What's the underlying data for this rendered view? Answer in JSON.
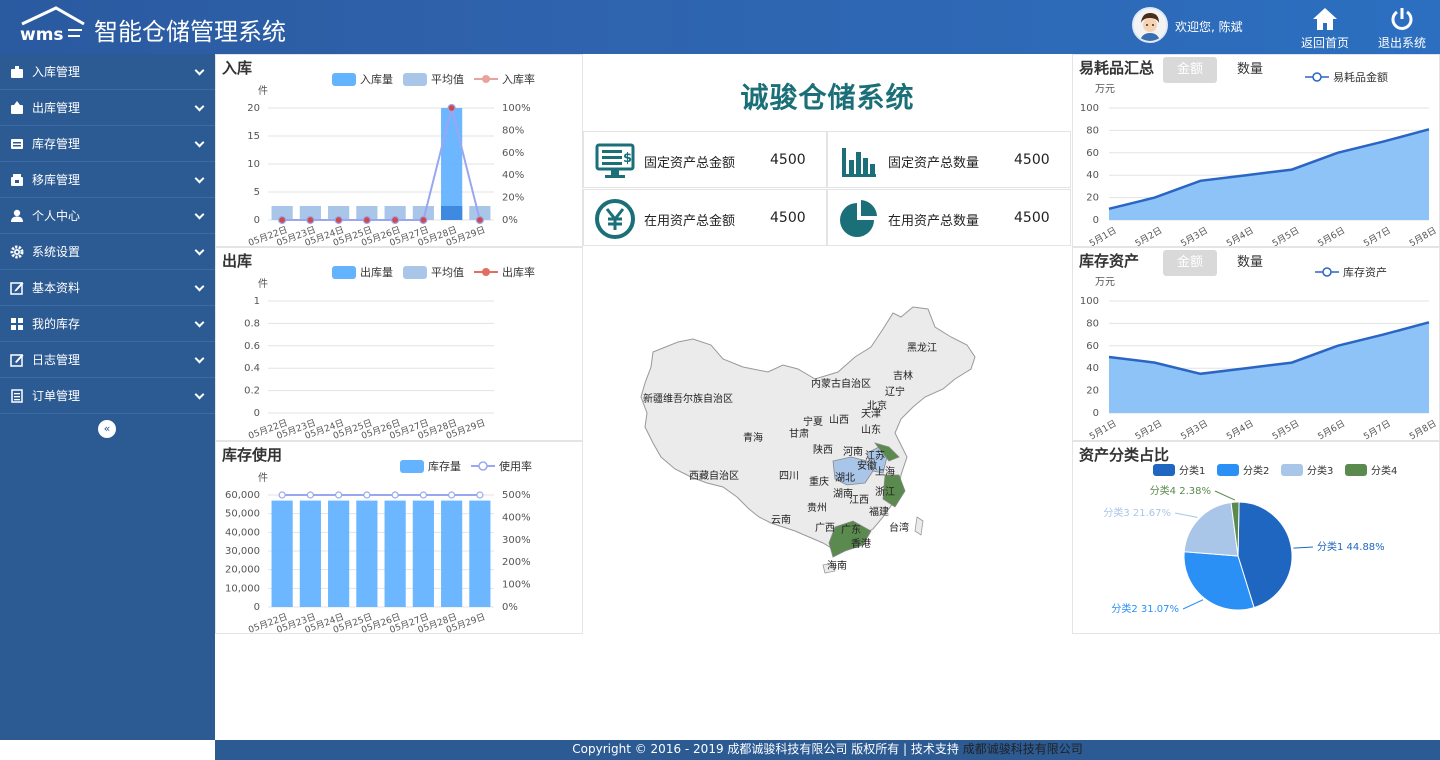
{
  "header": {
    "title": "智能仓储管理系统",
    "welcome": "欢迎您, 陈斌",
    "home_label": "返回首页",
    "logout_label": "退出系统"
  },
  "sidebar": {
    "items": [
      {
        "label": "入库管理",
        "icon": "inbox-in-icon"
      },
      {
        "label": "出库管理",
        "icon": "inbox-out-icon"
      },
      {
        "label": "库存管理",
        "icon": "inventory-icon"
      },
      {
        "label": "移库管理",
        "icon": "transfer-icon"
      },
      {
        "label": "个人中心",
        "icon": "user-icon"
      },
      {
        "label": "系统设置",
        "icon": "gear-icon"
      },
      {
        "label": "基本资料",
        "icon": "edit-icon"
      },
      {
        "label": "我的库存",
        "icon": "grid-icon"
      },
      {
        "label": "日志管理",
        "icon": "log-icon"
      },
      {
        "label": "订单管理",
        "icon": "list-icon"
      }
    ],
    "collapse_symbol": "«"
  },
  "center": {
    "title": "诚骏仓储系统",
    "stats": [
      {
        "label": "固定资产总金额",
        "value": "4500",
        "icon": "monitor-money-icon"
      },
      {
        "label": "固定资产总数量",
        "value": "4500",
        "icon": "bar-chart-icon"
      },
      {
        "label": "在用资产总金额",
        "value": "4500",
        "icon": "yen-icon"
      },
      {
        "label": "在用资产总数量",
        "value": "4500",
        "icon": "pie-icon"
      }
    ]
  },
  "panels": {
    "inbound": {
      "title": "入库",
      "legend": [
        "入库量",
        "平均值",
        "入库率"
      ]
    },
    "outbound": {
      "title": "出库",
      "legend": [
        "出库量",
        "平均值",
        "出库率"
      ]
    },
    "stock_use": {
      "title": "库存使用",
      "legend": [
        "库存量",
        "使用率"
      ]
    },
    "consumables": {
      "title": "易耗品汇总",
      "tab_amount": "金额",
      "tab_count": "数量",
      "legend": [
        "易耗品金额"
      ]
    },
    "stock_assets": {
      "title": "库存资产",
      "tab_amount": "金额",
      "tab_count": "数量",
      "legend": [
        "库存资产"
      ]
    },
    "asset_ratio": {
      "title": "资产分类占比"
    }
  },
  "footer": {
    "text": "Copyright © 2016 - 2019 成都诚骏科技有限公司 版权所有 | 技术支持 ",
    "company": "成都诚骏科技有限公司"
  },
  "colors": {
    "accent": "#2c5a93",
    "bar": "#64b3ff",
    "line": "#2a65c4",
    "area": "#8ec3f7",
    "teal": "#1a6f78"
  },
  "chart_data": [
    {
      "id": "inbound",
      "type": "bar",
      "categories": [
        "05月22日",
        "05月23日",
        "05月24日",
        "05月25日",
        "05月26日",
        "05月27日",
        "05月28日",
        "05月29日"
      ],
      "y_unit": "件",
      "ylim": [
        0,
        20
      ],
      "yticks": [
        "0",
        "5",
        "10",
        "15",
        "20"
      ],
      "y2ticks": [
        "0%",
        "20%",
        "40%",
        "60%",
        "80%",
        "100%"
      ],
      "series": [
        {
          "name": "入库量",
          "values": [
            0,
            0,
            0,
            0,
            0,
            0,
            20,
            0
          ]
        },
        {
          "name": "平均值",
          "values": [
            2.5,
            2.5,
            2.5,
            2.5,
            2.5,
            2.5,
            2.5,
            2.5
          ]
        },
        {
          "name": "入库率",
          "values": [
            0,
            0,
            0,
            0,
            0,
            0,
            100,
            0
          ]
        }
      ]
    },
    {
      "id": "outbound",
      "type": "bar",
      "categories": [
        "05月22日",
        "05月23日",
        "05月24日",
        "05月25日",
        "05月26日",
        "05月27日",
        "05月28日",
        "05月29日"
      ],
      "y_unit": "件",
      "ylim": [
        0,
        1
      ],
      "yticks": [
        "0",
        "0.2",
        "0.4",
        "0.6",
        "0.8",
        "1"
      ],
      "series": [
        {
          "name": "出库量",
          "values": [
            0,
            0,
            0,
            0,
            0,
            0,
            0,
            0
          ]
        },
        {
          "name": "平均值",
          "values": [
            0,
            0,
            0,
            0,
            0,
            0,
            0,
            0
          ]
        },
        {
          "name": "出库率",
          "values": [
            0,
            0,
            0,
            0,
            0,
            0,
            0,
            0
          ]
        }
      ]
    },
    {
      "id": "stock_use",
      "type": "bar",
      "categories": [
        "05月22日",
        "05月23日",
        "05月24日",
        "05月25日",
        "05月26日",
        "05月27日",
        "05月28日",
        "05月29日"
      ],
      "y_unit": "件",
      "ylim": [
        0,
        60000
      ],
      "yticks": [
        "0",
        "10,000",
        "20,000",
        "30,000",
        "40,000",
        "50,000",
        "60,000"
      ],
      "y2ticks": [
        "0%",
        "100%",
        "200%",
        "300%",
        "400%",
        "500%"
      ],
      "series": [
        {
          "name": "库存量",
          "values": [
            57000,
            57000,
            57000,
            57000,
            57000,
            57000,
            57000,
            57000
          ]
        },
        {
          "name": "使用率",
          "values": [
            500,
            500,
            500,
            500,
            500,
            500,
            500,
            500
          ]
        }
      ]
    },
    {
      "id": "consumables",
      "type": "area",
      "categories": [
        "5月1日",
        "5月2日",
        "5月3日",
        "5月4日",
        "5月5日",
        "5月6日",
        "5月7日",
        "5月8日"
      ],
      "y_unit": "万元",
      "ylim": [
        0,
        100
      ],
      "yticks": [
        "0",
        "20",
        "40",
        "60",
        "80",
        "100"
      ],
      "series": [
        {
          "name": "易耗品金额",
          "values": [
            10,
            20,
            35,
            40,
            45,
            60,
            70,
            81
          ]
        }
      ]
    },
    {
      "id": "stock_assets",
      "type": "area",
      "categories": [
        "5月1日",
        "5月2日",
        "5月3日",
        "5月4日",
        "5月5日",
        "5月6日",
        "5月7日",
        "5月8日"
      ],
      "y_unit": "万元",
      "ylim": [
        0,
        100
      ],
      "yticks": [
        "0",
        "20",
        "40",
        "60",
        "80",
        "100"
      ],
      "series": [
        {
          "name": "库存资产",
          "values": [
            50,
            45,
            35,
            40,
            45,
            60,
            70,
            81
          ]
        }
      ]
    },
    {
      "id": "asset_ratio",
      "type": "pie",
      "legend_placement": "top",
      "slices": [
        {
          "name": "分类1",
          "value": 44.88,
          "label": "分类1 44.88%",
          "color": "#1f66c1"
        },
        {
          "name": "分类2",
          "value": 31.07,
          "label": "分类2 31.07%",
          "color": "#2a90f5"
        },
        {
          "name": "分类3",
          "value": 21.67,
          "label": "分类3 21.67%",
          "color": "#a9c6e8"
        },
        {
          "name": "分类4",
          "value": 2.38,
          "label": "分类4 2.38%",
          "color": "#5b8a4e"
        }
      ]
    }
  ],
  "map": {
    "labels": [
      "黑龙江",
      "吉林",
      "辽宁",
      "内蒙古自治区",
      "新疆维吾尔族自治区",
      "宁夏",
      "北京",
      "天津",
      "山西",
      "山东",
      "甘肃",
      "青海",
      "陕西",
      "河南",
      "江苏",
      "安徽",
      "上海",
      "湖北",
      "四川",
      "重庆",
      "西藏自治区",
      "浙江",
      "湖南",
      "江西",
      "贵州",
      "福建",
      "云南",
      "广西",
      "广东",
      "台湾",
      "香港",
      "海南"
    ]
  }
}
